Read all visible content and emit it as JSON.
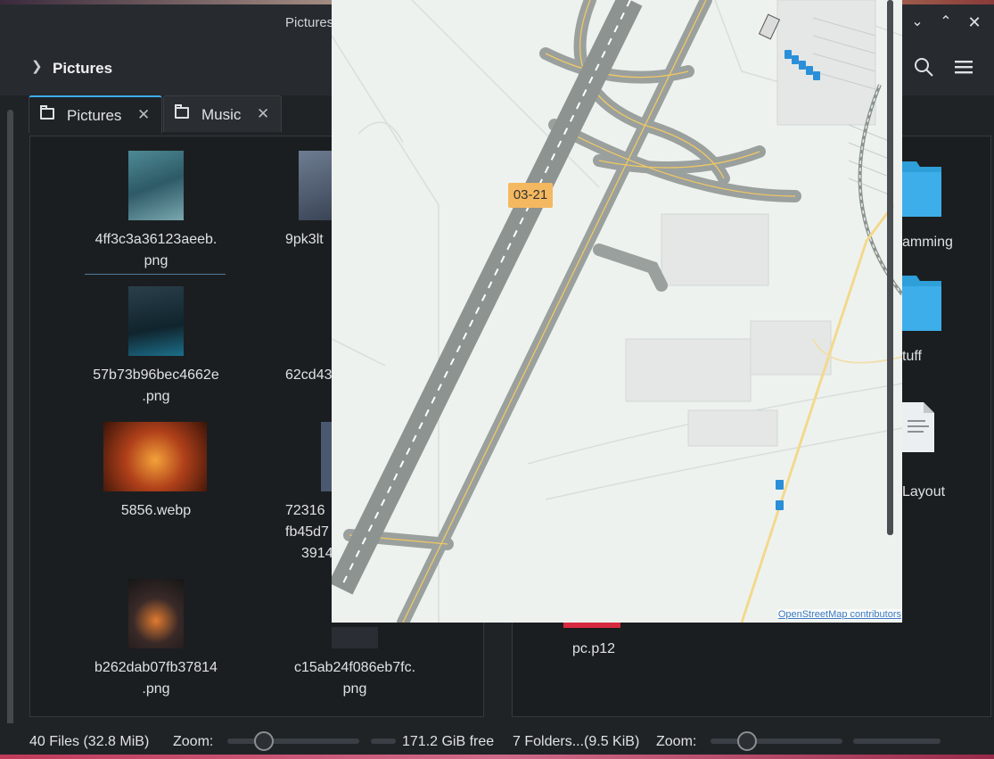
{
  "window": {
    "title": "Pictures",
    "breadcrumb": "Pictures"
  },
  "tabs": [
    {
      "label": "Pictures"
    },
    {
      "label": "Music"
    }
  ],
  "left_pane": {
    "items": [
      {
        "name_l1": "4ff3c3a36123aeeb.",
        "name_l2": "png"
      },
      {
        "name_l1": "9pk3lt",
        "name_l2": ""
      },
      {
        "name_l1": "57b73b96bec4662e",
        "name_l2": ".png"
      },
      {
        "name_l1": "62cd43",
        "name_l2": ""
      },
      {
        "name_l1": "5856.webp",
        "name_l2": ""
      },
      {
        "name_l1": "72316",
        "name_l2": "fb45d7",
        "name_l3": "3914"
      },
      {
        "name_l1": "b262dab07fb37814",
        "name_l2": ".png"
      },
      {
        "name_l1": "c15ab24f086eb7fc.",
        "name_l2": "png"
      }
    ]
  },
  "right_pane": {
    "items": [
      {
        "name": "amming"
      },
      {
        "name": "tuff"
      },
      {
        "name": "Layout"
      },
      {
        "name": "pc.p12"
      }
    ]
  },
  "status": {
    "left_count": "40 Files (32.8 MiB)",
    "left_zoom_label": "Zoom:",
    "free_space": "171.2 GiB free",
    "right_count": "7 Folders...(9.5 KiB)",
    "right_zoom_label": "Zoom:"
  },
  "map": {
    "runway_label": "03-21",
    "attribution": "OpenStreetMap contributors"
  },
  "colors": {
    "accent": "#3daee9",
    "folder": "#2e9fd8",
    "runway_label_bg": "#f4b860"
  }
}
